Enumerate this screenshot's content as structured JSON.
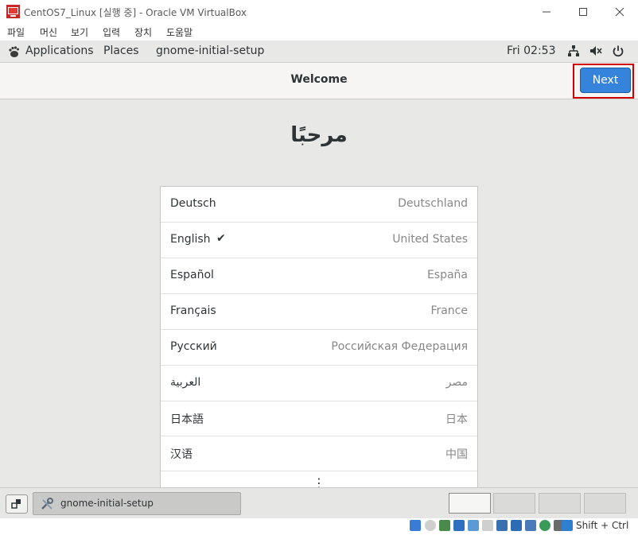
{
  "window": {
    "title": "CentOS7_Linux [실행 중] - Oracle VM VirtualBox",
    "controls": [
      "minimize",
      "maximize",
      "close"
    ]
  },
  "menubar": {
    "items": [
      "파일",
      "머신",
      "보기",
      "입력",
      "장치",
      "도움말"
    ]
  },
  "gnome_topbar": {
    "applications": "Applications",
    "places": "Places",
    "app_name": "gnome-initial-setup",
    "clock": "Fri 02:53",
    "status_icons": [
      "network-icon",
      "volume-icon",
      "power-icon"
    ]
  },
  "header": {
    "title": "Welcome",
    "next_label": "Next"
  },
  "main": {
    "welcome_text": "مرحبًا",
    "languages": [
      {
        "name": "Deutsch",
        "region": "Deutschland",
        "selected": false
      },
      {
        "name": "English",
        "region": "United States",
        "selected": true
      },
      {
        "name": "Español",
        "region": "España",
        "selected": false
      },
      {
        "name": "Français",
        "region": "France",
        "selected": false
      },
      {
        "name": "Русский",
        "region": "Российская Федерация",
        "selected": false
      },
      {
        "name": "العربية",
        "region": "مصر",
        "selected": false
      },
      {
        "name": "日本語",
        "region": "日本",
        "selected": false
      },
      {
        "name": "汉语",
        "region": "中国",
        "selected": false
      }
    ],
    "more_indicator": "⋮",
    "check_mark": "✔"
  },
  "taskbar": {
    "task_label": "gnome-initial-setup",
    "workspaces": 4,
    "active_workspace": 1
  },
  "statusbar": {
    "host_key": "Shift + Ctrl"
  },
  "colors": {
    "accent": "#3583db",
    "highlight_border": "#d00000",
    "content_bg": "#e8e8e7"
  }
}
